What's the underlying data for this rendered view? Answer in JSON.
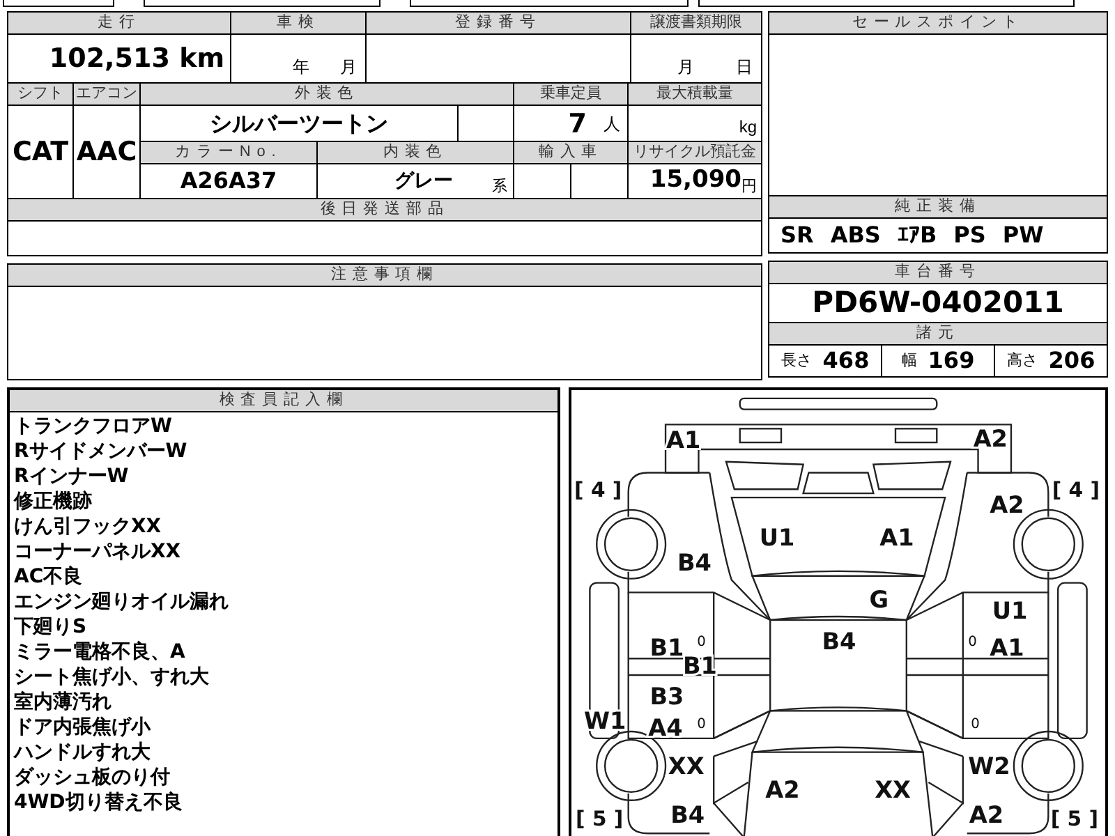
{
  "sheet": {
    "odometer": {
      "label": "走行",
      "value": "102,513",
      "unit": "km"
    },
    "inspection": {
      "label": "車検",
      "year_unit": "年",
      "month_unit": "月"
    },
    "registration_number": {
      "label": "登録番号"
    },
    "transfer_deadline": {
      "label": "譲渡書類期限",
      "month_unit": "月",
      "day_unit": "日"
    },
    "shift": {
      "label": "シフト",
      "value": "CAT"
    },
    "air_conditioning": {
      "label": "エアコン",
      "value": "AAC"
    },
    "exterior_color": {
      "label": "外装色",
      "value": "シルバーツートン"
    },
    "capacity": {
      "label": "乗車定員",
      "value": "7",
      "unit": "人"
    },
    "max_load": {
      "label": "最大積載量",
      "unit": "kg"
    },
    "color_number": {
      "label": "カラーNo.",
      "value": "A26A37"
    },
    "interior_color": {
      "label": "内装色",
      "value": "グレー",
      "suffix": "系"
    },
    "imported": {
      "label": "輸入車"
    },
    "recycling_deposit": {
      "label": "リサイクル預託金",
      "value": "15,090",
      "unit": "円"
    },
    "parts_shipped_later": {
      "label": "後日発送部品"
    },
    "notes": {
      "label": "注意事項欄"
    }
  },
  "sales_points": {
    "label": "セールスポイント"
  },
  "standard_equipment": {
    "label": "純正装備",
    "items": [
      "SR",
      "ABS",
      "ｴｱB",
      "PS",
      "PW"
    ]
  },
  "chassis_number": {
    "label": "車台番号",
    "value": "PD6W-0402011"
  },
  "specs": {
    "label": "諸元",
    "items": [
      {
        "label": "長さ",
        "value": "468"
      },
      {
        "label": "幅",
        "value": "169"
      },
      {
        "label": "高さ",
        "value": "206"
      }
    ]
  },
  "inspector_notes": {
    "label": "検査員記入欄",
    "lines": [
      "トランクフロアW",
      "RサイドメンバーW",
      "RインナーW",
      "修正機跡",
      "けん引フックXX",
      "コーナーパネルXX",
      "AC不良",
      "エンジン廻りオイル漏れ",
      "下廻りS",
      "ミラー電格不良、A",
      "シート焦げ小、すれ大",
      "室内薄汚れ",
      "ドア内張焦げ小",
      "ハンドルすれ大",
      "ダッシュ板のり付",
      "4WD切り替え不良"
    ]
  },
  "diagram": {
    "marks": [
      {
        "kind": "damage",
        "text": "A1"
      },
      {
        "kind": "damage",
        "text": "A2"
      },
      {
        "kind": "score",
        "text": "[ 4 ]"
      },
      {
        "kind": "score",
        "text": "[ 4 ]"
      },
      {
        "kind": "damage",
        "text": "A2"
      },
      {
        "kind": "damage",
        "text": "U1"
      },
      {
        "kind": "damage",
        "text": "A1"
      },
      {
        "kind": "damage",
        "text": "B4"
      },
      {
        "kind": "damage",
        "text": "G"
      },
      {
        "kind": "damage",
        "text": "U1"
      },
      {
        "kind": "damage",
        "text": "B1"
      },
      {
        "kind": "small",
        "text": "0"
      },
      {
        "kind": "damage",
        "text": "B4"
      },
      {
        "kind": "small",
        "text": "0"
      },
      {
        "kind": "damage",
        "text": "A1"
      },
      {
        "kind": "damage",
        "text": "B1"
      },
      {
        "kind": "damage",
        "text": "B3"
      },
      {
        "kind": "damage",
        "text": "W1"
      },
      {
        "kind": "damage",
        "text": "A4"
      },
      {
        "kind": "small",
        "text": "0"
      },
      {
        "kind": "small",
        "text": "0"
      },
      {
        "kind": "damage",
        "text": "XX"
      },
      {
        "kind": "damage",
        "text": "W2"
      },
      {
        "kind": "damage",
        "text": "A2"
      },
      {
        "kind": "damage",
        "text": "XX"
      },
      {
        "kind": "score",
        "text": "[ 5 ]"
      },
      {
        "kind": "damage",
        "text": "B4"
      },
      {
        "kind": "damage",
        "text": "A2"
      },
      {
        "kind": "score",
        "text": "[ 5 ]"
      }
    ]
  }
}
